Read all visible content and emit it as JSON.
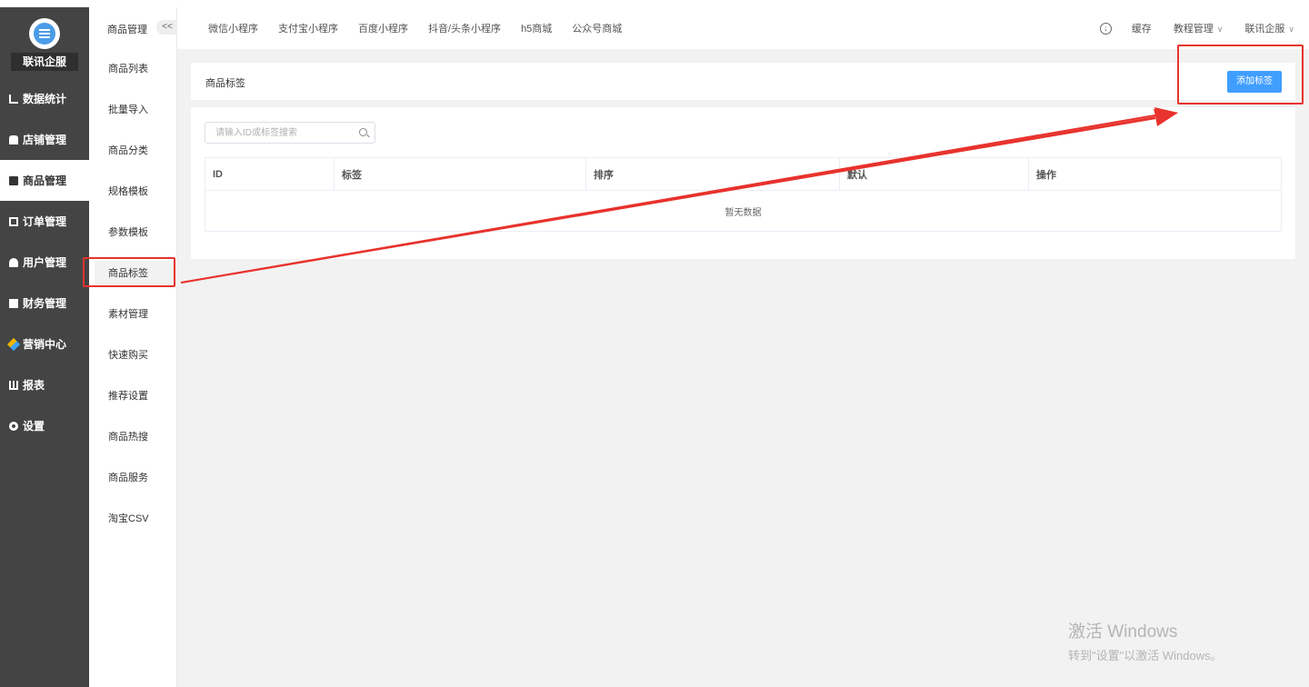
{
  "brand": "联讯企服",
  "sidebar": {
    "items": [
      {
        "label": "数据统计",
        "icon": "chart-icon"
      },
      {
        "label": "店铺管理",
        "icon": "store-icon"
      },
      {
        "label": "商品管理",
        "icon": "goods-icon"
      },
      {
        "label": "订单管理",
        "icon": "order-icon"
      },
      {
        "label": "用户管理",
        "icon": "user-icon"
      },
      {
        "label": "财务管理",
        "icon": "finance-icon"
      },
      {
        "label": "营销中心",
        "icon": "marketing-icon"
      },
      {
        "label": "报表",
        "icon": "report-icon"
      },
      {
        "label": "设置",
        "icon": "settings-icon"
      }
    ]
  },
  "subnav": {
    "title": "商品管理",
    "collapse": "<<",
    "items": [
      "商品列表",
      "批量导入",
      "商品分类",
      "规格模板",
      "参数模板",
      "商品标签",
      "素材管理",
      "快速购买",
      "推荐设置",
      "商品热搜",
      "商品服务",
      "淘宝CSV"
    ]
  },
  "topbar": {
    "tabs": [
      "微信小程序",
      "支付宝小程序",
      "百度小程序",
      "抖音/头条小程序",
      "h5商城",
      "公众号商城"
    ],
    "cache": "缓存",
    "tutorial": "教程管理",
    "user": "联讯企服",
    "download_icon": "download-icon"
  },
  "page": {
    "title": "商品标签",
    "add_button": "添加标签",
    "search_placeholder": "请输入ID或标签搜索"
  },
  "table": {
    "headers": [
      "ID",
      "标签",
      "排序",
      "默认",
      "操作"
    ],
    "empty_text": "暂无数据"
  },
  "watermark": {
    "line1": "激活 Windows",
    "line2": "转到\"设置\"以激活 Windows。"
  },
  "colors": {
    "sidebar_bg": "#444444",
    "accent": "#409eff",
    "annotation": "#e8322d"
  }
}
